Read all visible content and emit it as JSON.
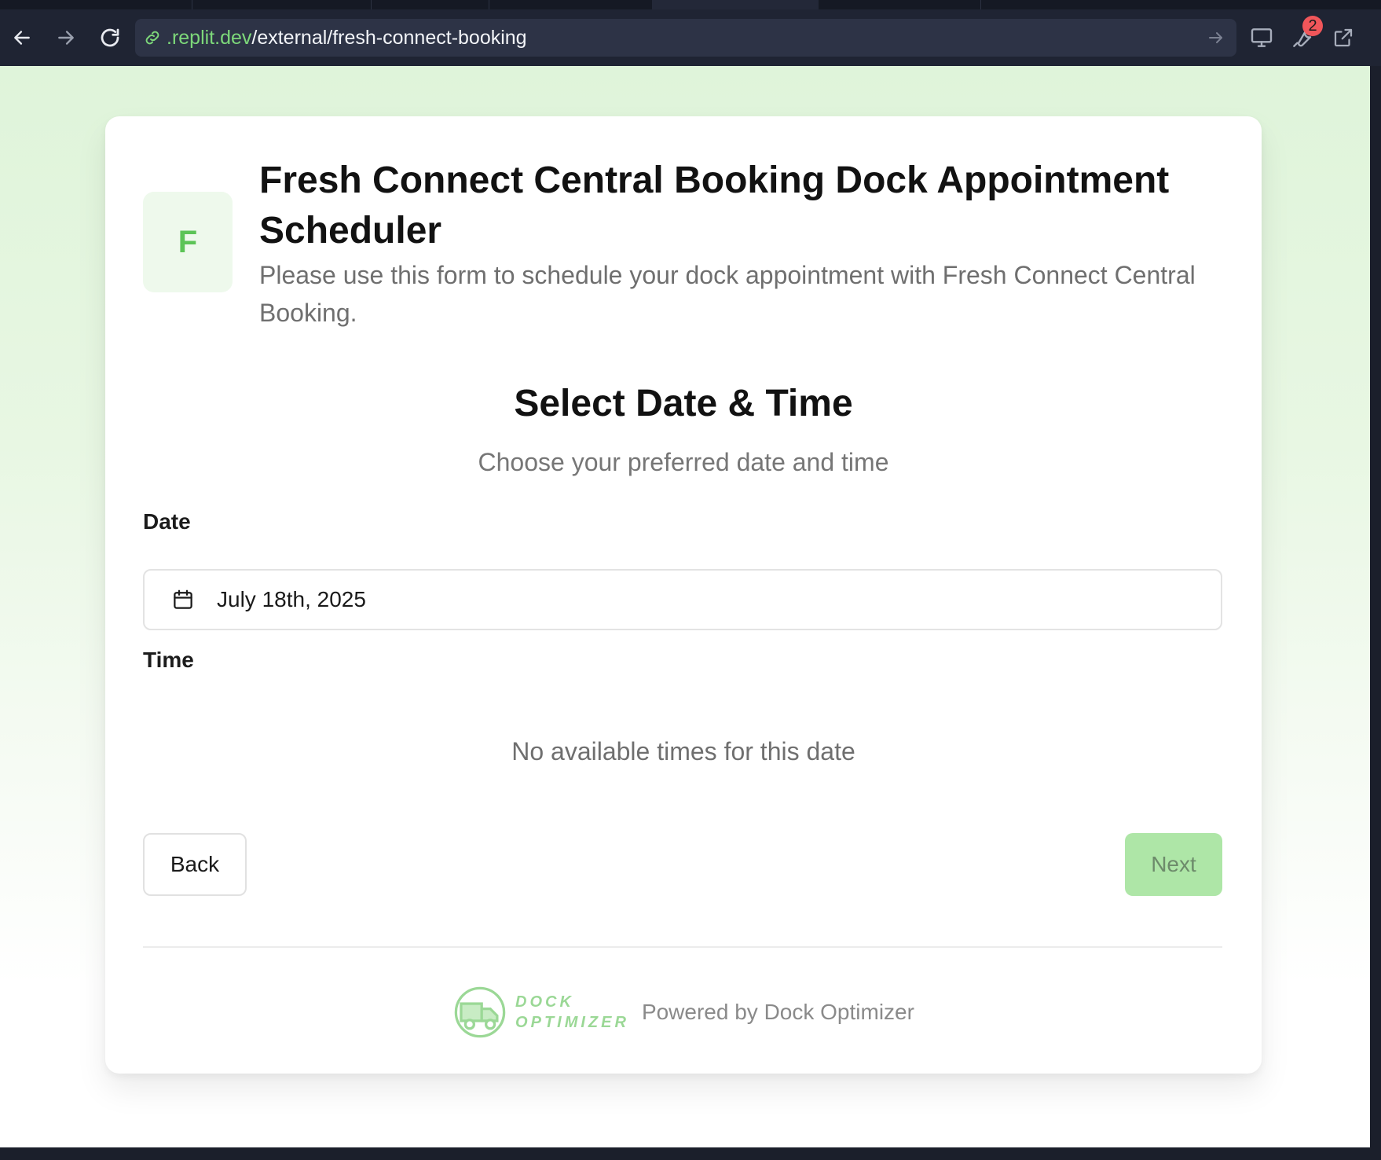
{
  "browser": {
    "url_host": ".replit.dev",
    "url_path": "/external/fresh-connect-booking",
    "notification_count": "2"
  },
  "brand": {
    "initial": "F",
    "accent_color": "#5cc457",
    "button_disabled_color": "#aee6a7"
  },
  "header": {
    "title": "Fresh Connect Central Booking Dock Appointment Scheduler",
    "subtitle": "Please use this form to schedule your dock appointment with Fresh Connect Central Booking."
  },
  "step": {
    "title": "Select Date & Time",
    "subtitle": "Choose your preferred date and time"
  },
  "form": {
    "date_label": "Date",
    "date_value": "July 18th, 2025",
    "time_label": "Time",
    "no_times_message": "No available times for this date"
  },
  "actions": {
    "back_label": "Back",
    "next_label": "Next"
  },
  "footer": {
    "logo_line1": "DOCK",
    "logo_line2": "OPTIMIZER",
    "powered_by": "Powered by Dock Optimizer"
  }
}
